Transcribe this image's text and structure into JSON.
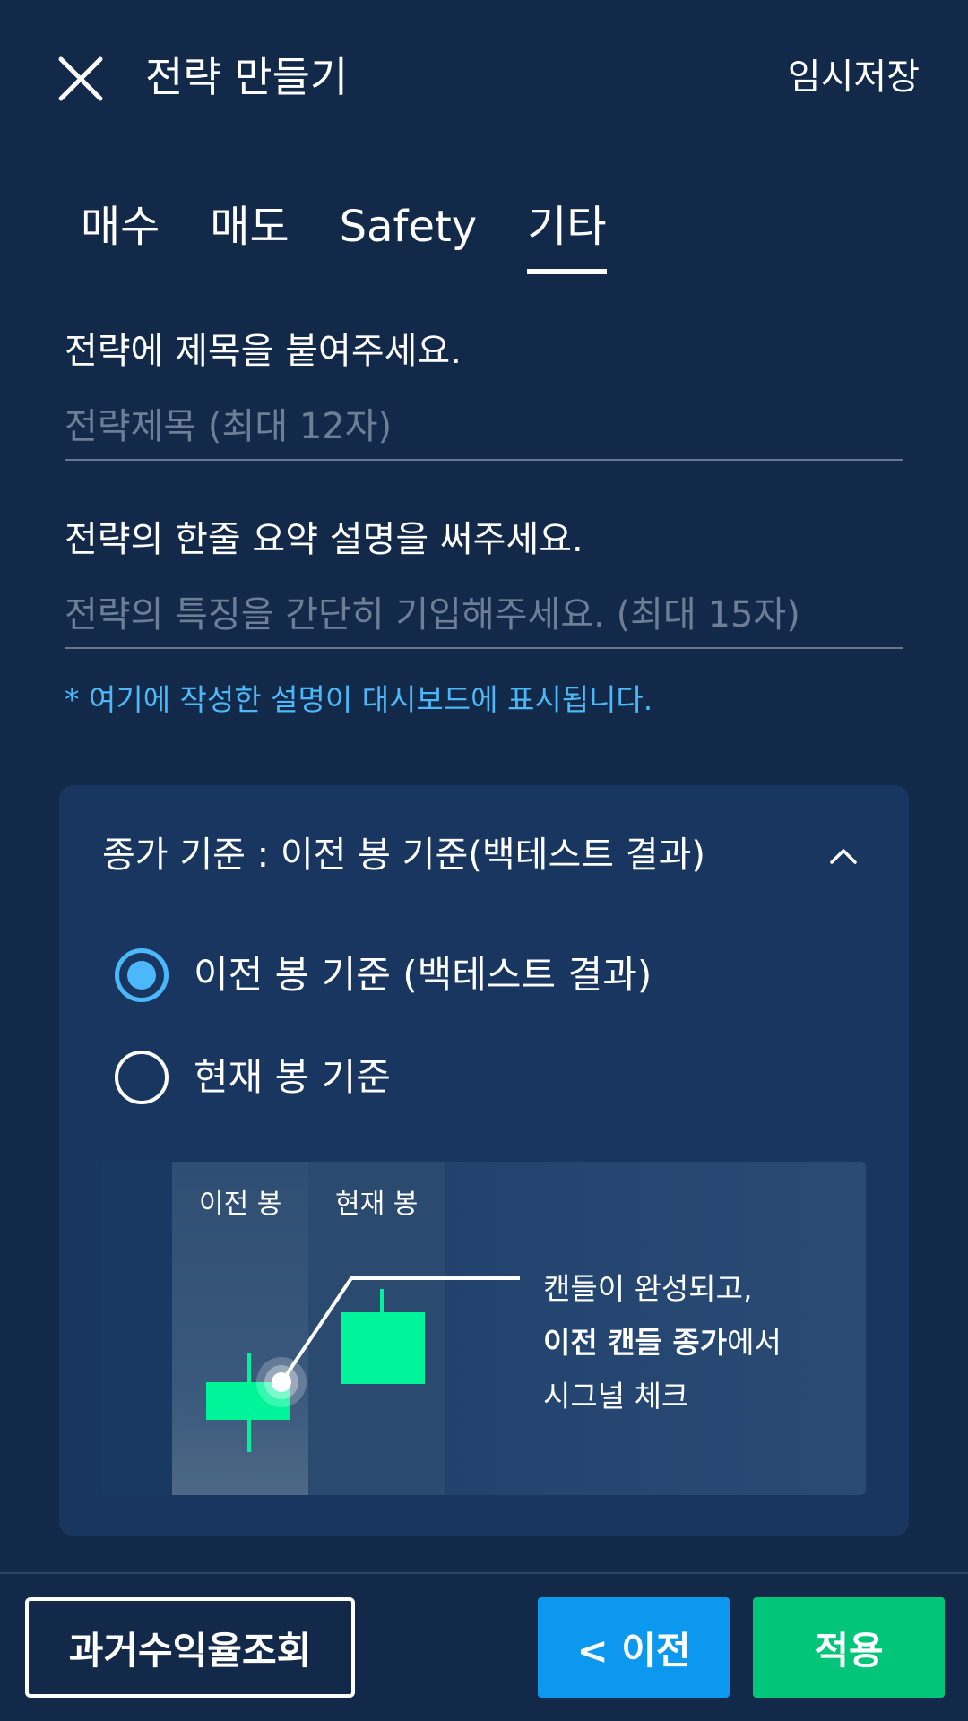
{
  "header": {
    "title": "전략 만들기",
    "save_draft": "임시저장",
    "close_icon": "close-icon"
  },
  "tabs": [
    {
      "label": "매수",
      "active": false
    },
    {
      "label": "매도",
      "active": false
    },
    {
      "label": "Safety",
      "active": false
    },
    {
      "label": "기타",
      "active": true
    }
  ],
  "form": {
    "title_label": "전략에 제목을 붙여주세요.",
    "title_placeholder": "전략제목 (최대 12자)",
    "title_value": "",
    "summary_label": "전략의 한줄 요약 설명을 써주세요.",
    "summary_placeholder": "전략의 특징을 간단히 기입해주세요. (최대 15자)",
    "summary_value": "",
    "hint": "* 여기에 작성한 설명이 대시보드에 표시됩니다."
  },
  "close_basis": {
    "header": "종가 기준 : 이전 봉 기준(백테스트 결과)",
    "expanded": true,
    "options": [
      {
        "label": "이전 봉 기준 (백테스트 결과)",
        "selected": true
      },
      {
        "label": "현재 봉 기준",
        "selected": false
      }
    ],
    "illustration": {
      "col_prev": "이전 봉",
      "col_current": "현재 봉",
      "desc_line1": "캔들이 완성되고,",
      "desc_bold": "이전 캔들 종가",
      "desc_line2_suffix": "에서",
      "desc_line3": "시그널 체크"
    }
  },
  "footer": {
    "history_button": "과거수익율조회",
    "prev_button": "< 이전",
    "apply_button": "적용"
  },
  "colors": {
    "background": "#13294a",
    "card": "#183660",
    "accent_blue": "#0b98ee",
    "accent_green": "#03c57a",
    "radio_selected": "#4ab8fb",
    "hint_text": "#4cb8f7",
    "candle_green": "#00f59a"
  }
}
